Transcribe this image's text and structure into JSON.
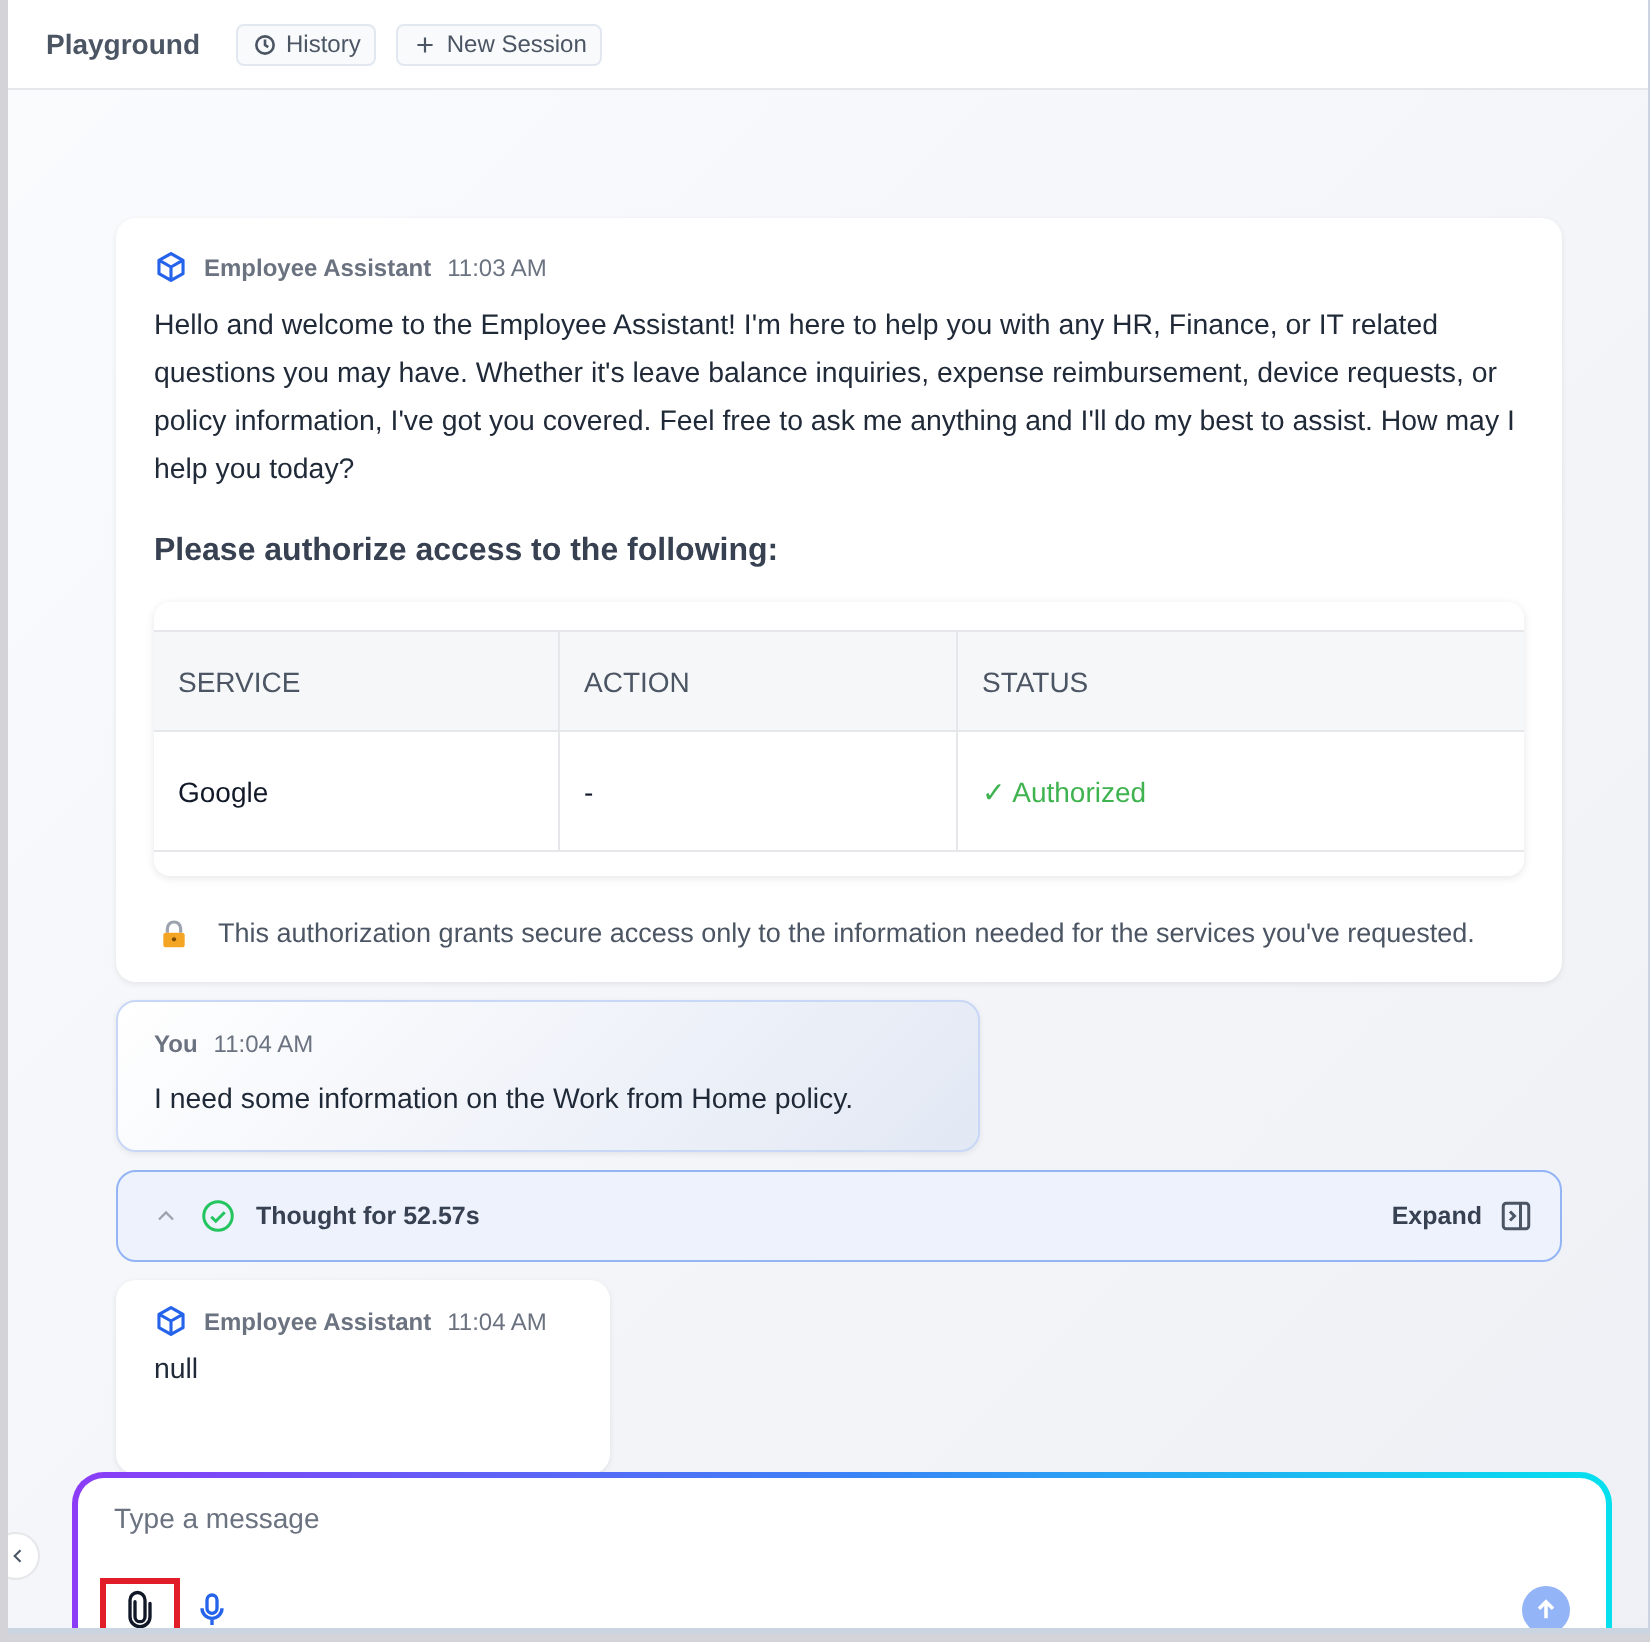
{
  "header": {
    "title": "Playground",
    "buttons": [
      {
        "kind": "history",
        "label": "History"
      },
      {
        "kind": "new",
        "label": "New Session"
      }
    ]
  },
  "messages": [
    {
      "kind": "assistant",
      "author": "Employee Assistant",
      "time": "11:03 AM",
      "text": "Hello and welcome to the Employee Assistant! I'm here to help you with any HR, Finance, or IT related questions you may have. Whether it's leave balance inquiries, expense reimbursement, device requests, or policy information, I've got you covered. Feel free to ask me anything and I'll do my best to assist. How may I help you today?",
      "auth": {
        "heading": "Please authorize access to the following:",
        "columns": [
          "SERVICE",
          "ACTION",
          "STATUS"
        ],
        "rows": [
          {
            "service": "Google",
            "action": "-",
            "status": "✓ Authorized",
            "authorized": true
          }
        ],
        "note": "This authorization grants secure access only to the information needed for the services you've requested."
      }
    },
    {
      "kind": "user",
      "author": "You",
      "time": "11:04 AM",
      "text": "I need some information on the Work from Home policy."
    },
    {
      "kind": "thought",
      "expanded": true,
      "text": "Thought for 52.57s",
      "action": "Expand"
    },
    {
      "kind": "assistant",
      "author": "Employee Assistant",
      "time": "11:04 AM",
      "text": "null"
    }
  ],
  "composer": {
    "placeholder": "Type a message",
    "attach_highlighted": true
  }
}
